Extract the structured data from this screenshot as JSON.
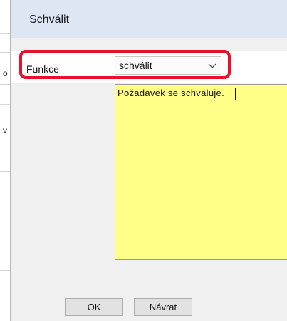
{
  "background_app": {
    "partial_chars": [
      "o",
      "v"
    ]
  },
  "dialog": {
    "title": "Schválit",
    "function_label": "Funkce",
    "function_select": {
      "value": "schválit"
    },
    "note_text": "Požadavek se schvaluje.",
    "buttons": {
      "ok": "OK",
      "back": "Návrat"
    }
  },
  "colors": {
    "highlight": "#e8102a",
    "note_background": "#ffff88",
    "titlebar": "#dde7f3"
  }
}
